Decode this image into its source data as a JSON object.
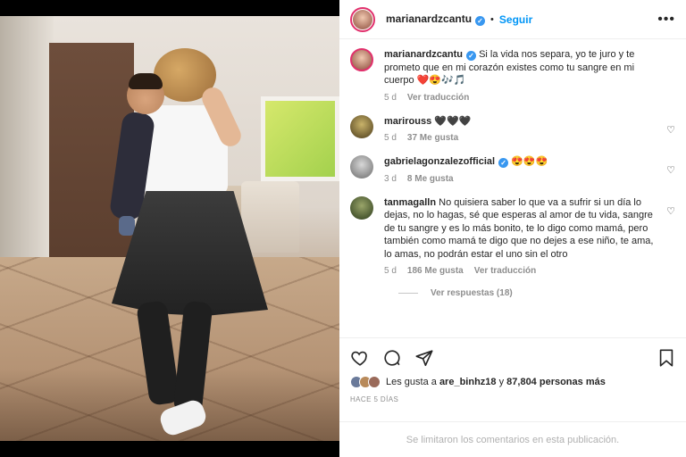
{
  "post": {
    "username": "marianardzcantu",
    "follow_label": "Seguir",
    "more_glyph": "•••",
    "photo_alt": "woman-dancing-with-baby"
  },
  "caption": {
    "username": "marianardzcantu",
    "text": "Si la vida nos separa, yo te juro y te prometo que en mi corazón existes como tu sangre en mi cuerpo",
    "emojis": "❤️😍🎶🎵",
    "time": "5 d",
    "translate": "Ver traducción"
  },
  "comments": [
    {
      "username": "marirouss",
      "text": "🖤🖤🖤",
      "time": "5 d",
      "likes": "37 Me gusta",
      "translate": "",
      "verified": false,
      "avatar_color": "#6b6a3a"
    },
    {
      "username": "gabrielagonzalezofficial",
      "text": "😍😍😍",
      "time": "3 d",
      "likes": "8 Me gusta",
      "translate": "",
      "verified": true,
      "avatar_color": "#8a8a8a"
    },
    {
      "username": "tanmagalln",
      "text": "No quisiera saber lo que va a sufrir si un día lo dejas, no lo hagas, sé que esperas al amor de tu vida, sangre de tu sangre y es lo más bonito, te lo digo como mamá, pero también como mamá te digo que no dejes a ese niño, te ama, lo amas, no podrán estar el uno sin el otro",
      "time": "5 d",
      "likes": "186 Me gusta",
      "translate": "Ver traducción",
      "verified": false,
      "avatar_color": "#4a5a2a"
    }
  ],
  "replies_label": "Ver respuestas (18)",
  "likes": {
    "prefix": "Les gusta a",
    "user": "are_binhz18",
    "joiner": "y",
    "others": "87,804 personas más"
  },
  "time_ago": "HACE 5 DÍAS",
  "footer": "Se limitaron los comentarios en esta publicación.",
  "colors": {
    "accent": "#0095f6",
    "verified": "#3897f0",
    "text": "#262626",
    "muted": "#8e8e8e"
  },
  "icons": [
    "heart-icon",
    "comment-icon",
    "share-icon",
    "save-icon",
    "verified-icon",
    "more-icon"
  ]
}
